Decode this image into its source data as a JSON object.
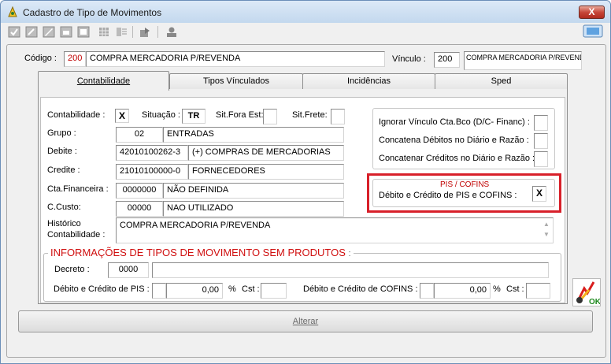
{
  "window": {
    "title": "Cadastro de Tipo de Movimentos",
    "close_label": "X"
  },
  "toolbar": {
    "icons": [
      "confirm-icon",
      "edit-icon",
      "edit-pen-icon",
      "delete-icon",
      "print-icon",
      "grid-icon",
      "list-icon",
      "export-icon",
      "user-icon",
      "monitor-icon"
    ]
  },
  "header": {
    "codigo_label": "Código :",
    "codigo_value": "200",
    "codigo_desc": "COMPRA MERCADORIA P/REVENDA",
    "vinculo_label": "Vínculo :",
    "vinculo_value": "200",
    "vinculo_desc": "COMPRA MERCADORIA P/REVENDA"
  },
  "tabs": [
    {
      "label": "Contabilidade"
    },
    {
      "label": "Tipos Vínculados"
    },
    {
      "label": "Incidências"
    },
    {
      "label": "Sped"
    }
  ],
  "contabilidade": {
    "contabilidade_label": "Contabilidade :",
    "contabilidade_value": "X",
    "situacao_label": "Situação :",
    "situacao_value": "TR",
    "sit_fora_est_label": "Sit.Fora Est:",
    "sit_fora_est_value": "",
    "sit_frete_label": "Sit.Frete:",
    "sit_frete_value": "",
    "grupo_label": "Grupo :",
    "grupo_code": "02",
    "grupo_desc": "ENTRADAS",
    "debito_label": "Debite :",
    "debito_code": "42010100262-3",
    "debito_desc": "(+) COMPRAS DE MERCADORIAS",
    "credito_label": "Credite :",
    "credito_code": "21010100000-0",
    "credito_desc": "FORNECEDORES",
    "cta_fin_label": "Cta.Financeira :",
    "cta_fin_code": "0000000",
    "cta_fin_desc": "NÃO DEFINIDA",
    "ccusto_label": "C.Custo:",
    "ccusto_code": "00000",
    "ccusto_desc": "NAO UTILIZADO",
    "historico_label_1": "Histórico",
    "historico_label_2": "Contabilidade :",
    "historico_value": "COMPRA MERCADORIA P/REVENDA",
    "ignorar_label": "Ignorar Vínculo Cta.Bco (D/C- Financ) :",
    "ignorar_value": "",
    "conc_deb_label": "Concatena Débitos  no Diário e Razão :",
    "conc_deb_value": "",
    "conc_cred_label": "Concatenar Créditos no Diário e Razão :",
    "conc_cred_value": "",
    "pis_cofins_title": "PIS / COFINS",
    "pis_cofins_label": "Débito e Crédito de PIS e COFINS :",
    "pis_cofins_value": "X"
  },
  "sem_produtos": {
    "title": "INFORMAÇÕES DE TIPOS DE MOVIMENTO SEM PRODUTOS",
    "title_suffix": ":",
    "decreto_label": "Decreto :",
    "decreto_code": "0000",
    "decreto_desc": "",
    "pis_label": "Débito e Crédito de PIS :",
    "pis_check": "",
    "pis_value": "0,00",
    "pis_pct": "%",
    "pis_cst_label": "Cst :",
    "pis_cst": "",
    "cofins_label": "Débito e Crédito de COFINS :",
    "cofins_check": "",
    "cofins_value": "0,00",
    "cofins_pct": "%",
    "cofins_cst_label": "Cst :",
    "cofins_cst": ""
  },
  "actions": {
    "alterar_label": "Alterar",
    "ok_label": "OK"
  }
}
